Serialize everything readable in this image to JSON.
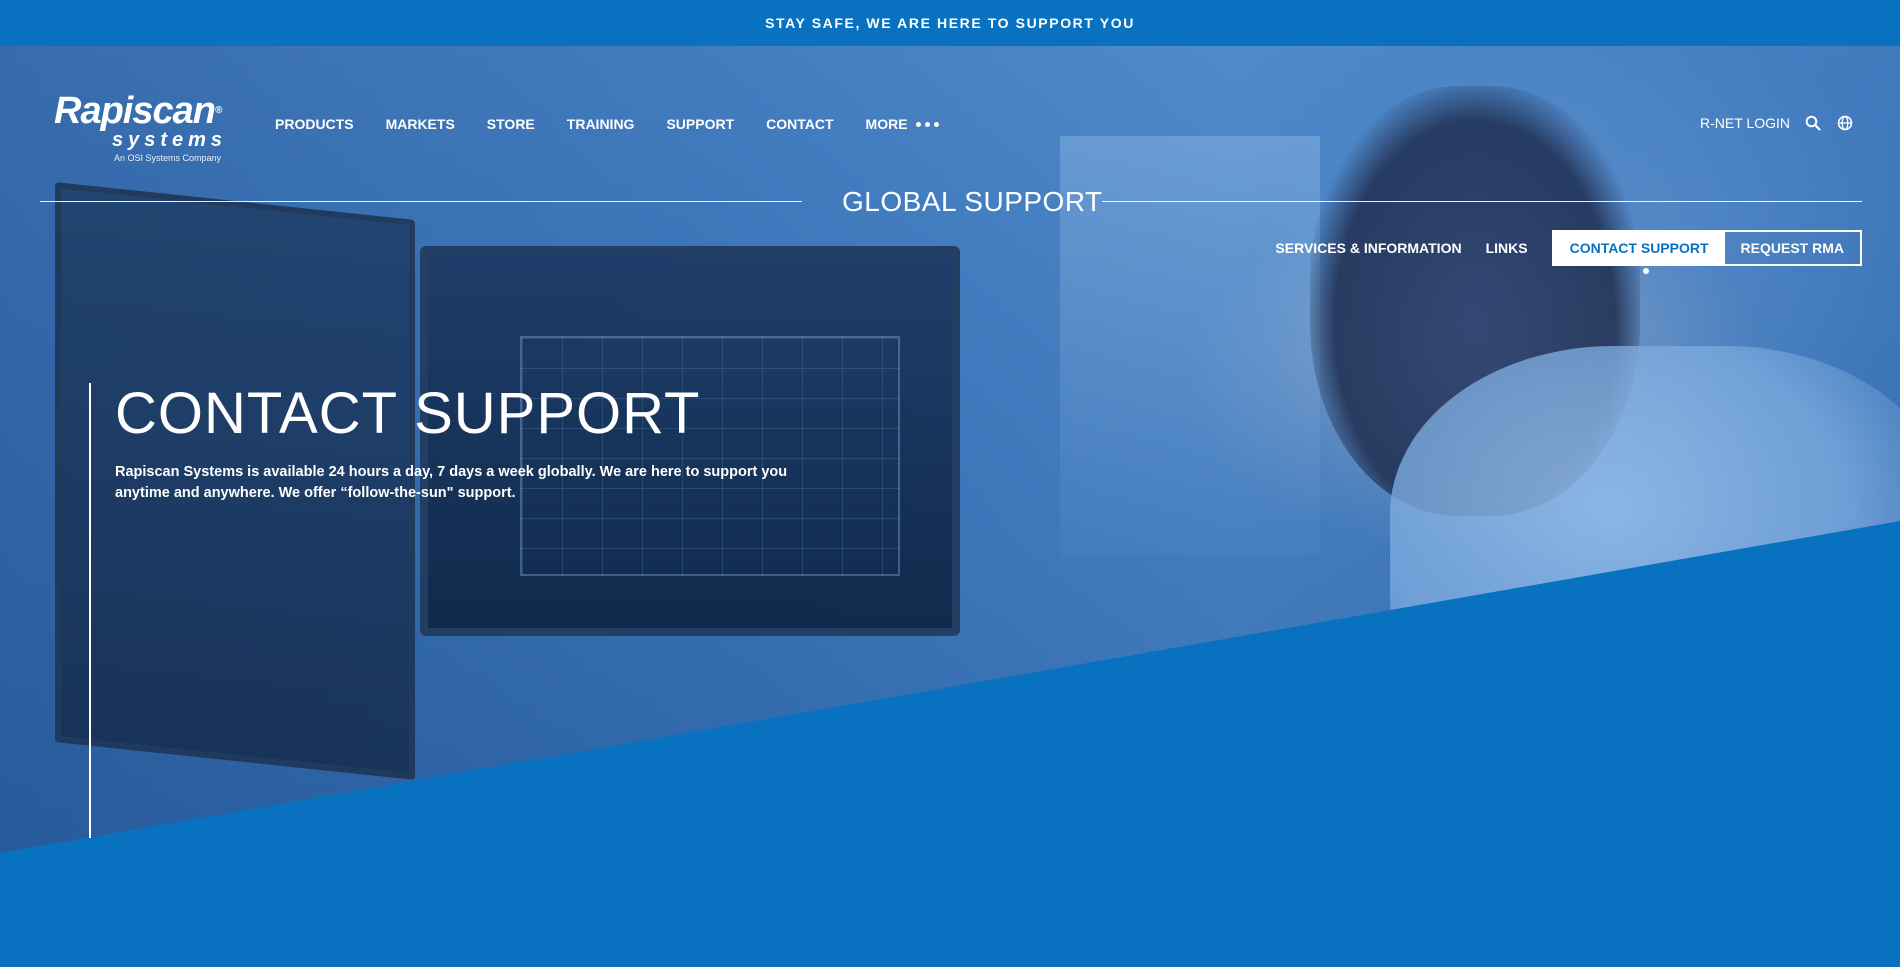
{
  "banner": {
    "text": "STAY SAFE, WE ARE HERE TO SUPPORT YOU"
  },
  "logo": {
    "brand": "Rapiscan",
    "trademark": "®",
    "sub": "systems",
    "tagline": "An OSI Systems Company"
  },
  "nav": {
    "items": [
      {
        "label": "PRODUCTS"
      },
      {
        "label": "MARKETS"
      },
      {
        "label": "STORE"
      },
      {
        "label": "TRAINING"
      },
      {
        "label": "SUPPORT"
      },
      {
        "label": "CONTACT"
      },
      {
        "label": "MORE"
      }
    ],
    "more_icon": "ellipsis-icon"
  },
  "header_right": {
    "login_label": "R-NET LOGIN",
    "search_icon": "search-icon",
    "globe_icon": "globe-icon"
  },
  "section": {
    "title": "GLOBAL SUPPORT"
  },
  "subnav": {
    "links": [
      {
        "label": "SERVICES & INFORMATION"
      },
      {
        "label": "LINKS"
      }
    ],
    "buttons": [
      {
        "label": "CONTACT SUPPORT",
        "active": true
      },
      {
        "label": "REQUEST RMA",
        "active": false
      }
    ]
  },
  "hero": {
    "title": "CONTACT SUPPORT",
    "description": "Rapiscan Systems is available 24 hours a day, 7 days a week globally. We are here to support you anytime and anywhere. We offer “follow-the-sun\" support."
  },
  "colors": {
    "brand_blue": "#0872c0",
    "white": "#ffffff"
  }
}
